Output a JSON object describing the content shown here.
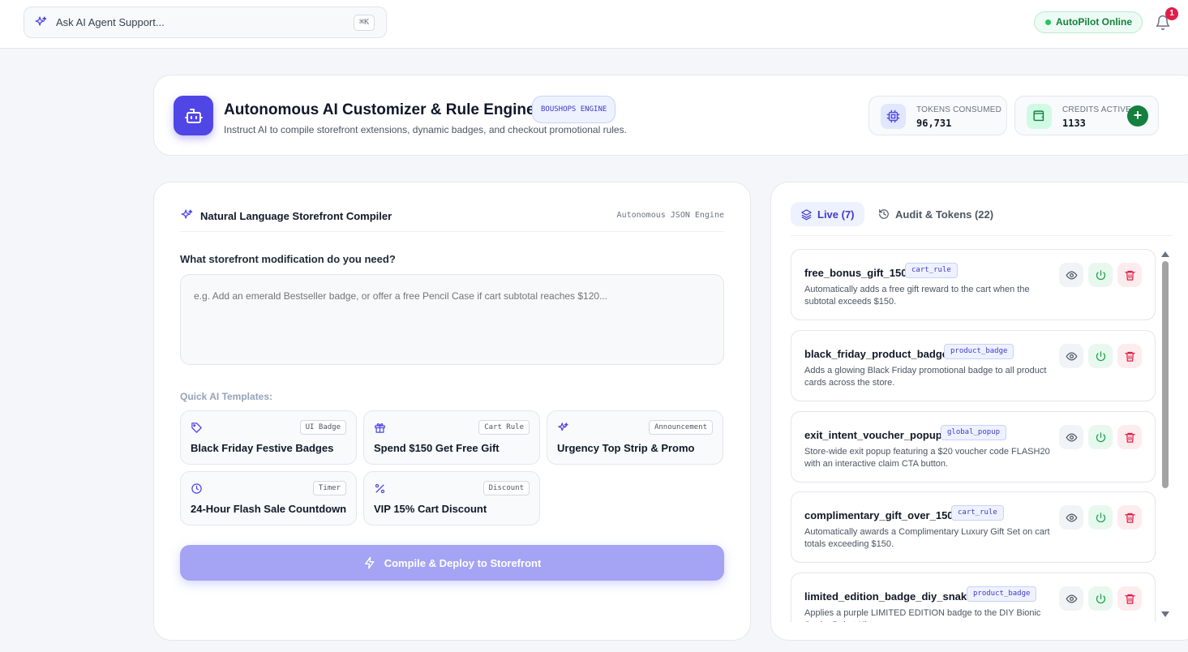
{
  "topbar": {
    "search_placeholder": "Ask AI Agent Support...",
    "shortcut": "⌘K",
    "status": "AutoPilot Online",
    "notification_count": "1"
  },
  "header": {
    "title": "Autonomous AI Customizer & Rule Engine",
    "engine_badge": "BOUSHOPS ENGINE",
    "subtitle": "Instruct AI to compile storefront extensions, dynamic badges, and checkout promotional rules.",
    "tokens_label": "TOKENS CONSUMED",
    "tokens_value": "96,731",
    "credits_label": "CREDITS ACTIVE",
    "credits_value": "1133",
    "add_credits": "+"
  },
  "compiler": {
    "title": "Natural Language Storefront Compiler",
    "engine": "Autonomous JSON Engine",
    "question": "What storefront modification do you need?",
    "placeholder": "e.g. Add an emerald Bestseller badge, or offer a free Pencil Case if cart subtotal reaches $120...",
    "templates_label": "Quick AI Templates:",
    "templates": [
      {
        "name": "Black Friday Festive Badges",
        "tag": "UI Badge",
        "icon": "tag-icon"
      },
      {
        "name": "Spend $150 Get Free Gift",
        "tag": "Cart Rule",
        "icon": "gift-icon"
      },
      {
        "name": "Urgency Top Strip & Promo",
        "tag": "Announcement",
        "icon": "sparkles-icon"
      },
      {
        "name": "24-Hour Flash Sale Countdown",
        "tag": "Timer",
        "icon": "clock-icon"
      },
      {
        "name": "VIP 15% Cart Discount",
        "tag": "Discount",
        "icon": "percent-icon"
      }
    ],
    "deploy_label": "Compile & Deploy to Storefront"
  },
  "panel": {
    "tab_live": "Live (7)",
    "tab_audit": "Audit & Tokens (22)",
    "rules": [
      {
        "name": "free_bonus_gift_150",
        "type": "cart_rule",
        "desc": "Automatically adds a free gift reward to the cart when the subtotal exceeds $150."
      },
      {
        "name": "black_friday_product_badge",
        "type": "product_badge",
        "desc": "Adds a glowing Black Friday promotional badge to all product cards across the store."
      },
      {
        "name": "exit_intent_voucher_popup",
        "type": "global_popup",
        "desc": "Store-wide exit popup featuring a $20 voucher code FLASH20 with an interactive claim CTA button."
      },
      {
        "name": "complimentary_gift_over_150",
        "type": "cart_rule",
        "desc": "Automatically awards a Complimentary Luxury Gift Set on cart totals exceeding $150."
      },
      {
        "name": "limited_edition_badge_diy_snake",
        "type": "product_badge",
        "desc": "Applies a purple LIMITED EDITION badge to the DIY Bionic Snake Robot Kit."
      }
    ]
  },
  "colors": {
    "accent": "#4f46e5",
    "success": "#15803d",
    "danger": "#e11d48"
  }
}
